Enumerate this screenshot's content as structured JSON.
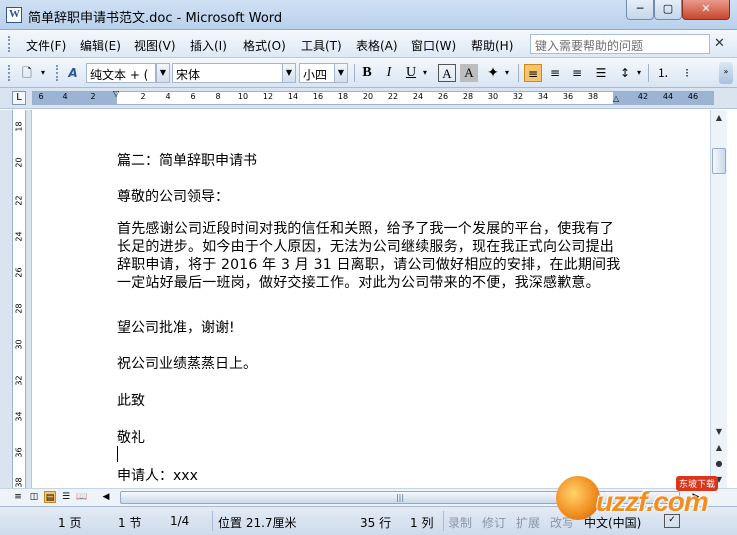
{
  "window": {
    "title": "简单辞职申请书范文.doc - Microsoft Word",
    "min_label": "─",
    "max_label": "▢",
    "close_label": "✕"
  },
  "menu": {
    "items": [
      "文件(F)",
      "编辑(E)",
      "视图(V)",
      "插入(I)",
      "格式(O)",
      "工具(T)",
      "表格(A)",
      "窗口(W)",
      "帮助(H)"
    ],
    "help_placeholder": "键入需要帮助的问题"
  },
  "toolbar": {
    "style_value": "纯文本 + (",
    "font_value": "宋体",
    "size_value": "小四",
    "bold": "B",
    "italic": "I",
    "underline": "U",
    "char_border": "A",
    "char_shading": "A"
  },
  "ruler": {
    "ticks": [
      "6",
      "4",
      "2",
      "",
      "2",
      "4",
      "6",
      "8",
      "10",
      "12",
      "14",
      "16",
      "18",
      "20",
      "22",
      "24",
      "26",
      "28",
      "30",
      "32",
      "34",
      "36",
      "38",
      "",
      "42",
      "44",
      "46"
    ],
    "vticks": [
      "18",
      "20",
      "22",
      "24",
      "26",
      "28",
      "30",
      "32",
      "34",
      "36",
      "38"
    ]
  },
  "document": {
    "lines": [
      "篇二：简单辞职申请书",
      "尊敬的公司领导：",
      "首先感谢公司近段时间对我的信任和关照，给予了我一个发展的平台，使我有了长足的进步。如今由于个人原因，无法为公司继续服务，现在我正式向公司提出辞职申请，将于 2016 年 3 月 31 日离职，请公司做好相应的安排，在此期间我一定站好最后一班岗，做好交接工作。对此为公司带来的不便，我深感歉意。",
      "望公司批准，谢谢!",
      "祝公司业绩蒸蒸日上。",
      "此致",
      "敬礼",
      "申请人：xxx"
    ]
  },
  "status": {
    "page": "1 页",
    "section": "1 节",
    "page_of": "1/4",
    "position": "位置 21.7厘米",
    "line": "35 行",
    "column": "1 列",
    "rec": "录制",
    "trk": "修订",
    "ext": "扩展",
    "ovr": "改写",
    "lang": "中文(中国)"
  },
  "watermark": {
    "text": "uzzf.com",
    "badge": "东坡下载"
  },
  "colors": {
    "accent": "#f7c46c",
    "titlebar": "#cfe0f3",
    "close": "#c8452d",
    "watermark": "#f48c1e"
  }
}
